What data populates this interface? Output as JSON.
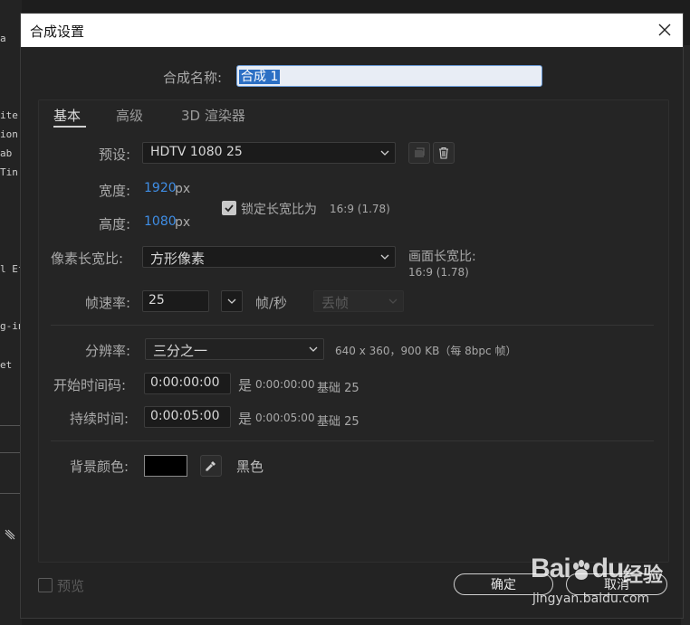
{
  "background_app": {
    "fragments": [
      "a",
      "ite",
      "ion",
      "ab",
      "Tin",
      "l Ef",
      "g-in",
      "et"
    ]
  },
  "dialog": {
    "title": "合成设置",
    "comp_name_label": "合成名称:",
    "comp_name_value": "合成 1",
    "tabs": [
      {
        "label": "基本",
        "active": true
      },
      {
        "label": "高级",
        "active": false
      },
      {
        "label": "3D 渲染器",
        "active": false
      }
    ],
    "preset": {
      "label": "预设:",
      "value": "HDTV 1080 25"
    },
    "width": {
      "label": "宽度:",
      "value": "1920",
      "unit": "px"
    },
    "height": {
      "label": "高度:",
      "value": "1080",
      "unit": "px"
    },
    "lock_aspect": {
      "label": "锁定长宽比为",
      "ratio": "16:9 (1.78)",
      "checked": true
    },
    "pixel_aspect": {
      "label": "像素长宽比:",
      "value": "方形像素"
    },
    "frame_aspect": {
      "label": "画面长宽比:",
      "value": "16:9 (1.78)"
    },
    "frame_rate": {
      "label": "帧速率:",
      "value": "25",
      "unit": "帧/秒",
      "drop_frame": "丢帧"
    },
    "resolution": {
      "label": "分辨率:",
      "value": "三分之一",
      "info": "640 x 360，900 KB（每 8bpc 帧）"
    },
    "start_timecode": {
      "label": "开始时间码:",
      "value": "0:00:00:00",
      "is_label": "是",
      "is_value": "0:00:00:00",
      "base": "基础 25"
    },
    "duration": {
      "label": "持续时间:",
      "value": "0:00:05:00",
      "is_label": "是",
      "is_value": "0:00:05:00",
      "base": "基础 25"
    },
    "background_color": {
      "label": "背景颜色:",
      "name": "黑色",
      "hex": "#000000"
    },
    "preview": {
      "label": "预览",
      "checked": false
    },
    "ok_label": "确定",
    "cancel_label": "取消"
  },
  "watermark": {
    "brand": "Bai",
    "brand2": "du",
    "cn": "经验",
    "url": "jingyan.baidu.com"
  },
  "colors": {
    "accent_blue": "#3f8ee6",
    "dialog_bg": "#232323",
    "titlebar_bg": "#ffffff",
    "selection": "#2b6fc4"
  }
}
